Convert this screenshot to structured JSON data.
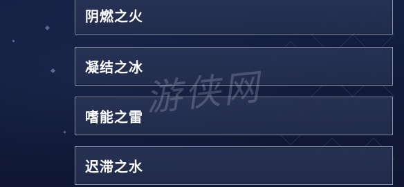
{
  "options": [
    {
      "label": "阴燃之火"
    },
    {
      "label": "凝结之冰"
    },
    {
      "label": "嗜能之雷"
    },
    {
      "label": "迟滞之水"
    }
  ],
  "watermark": "游侠网",
  "colors": {
    "background": "#131c3c",
    "option_border": "#8d97ac",
    "option_fill": "#2a3456",
    "text": "#ffffff"
  }
}
